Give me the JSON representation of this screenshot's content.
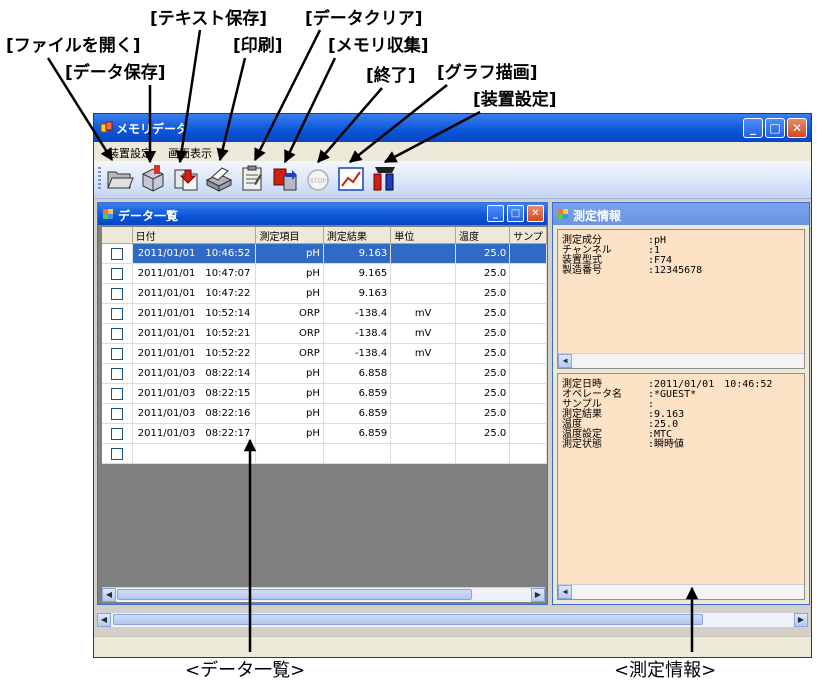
{
  "callouts": {
    "file_open": "[ファイルを開く]",
    "data_save": "[データ保存]",
    "text_save": "[テキスト保存]",
    "print": "[印刷]",
    "data_clear": "[データクリア]",
    "memory_collect": "[メモリ収集]",
    "exit": "[終了]",
    "graph_draw": "[グラフ描画]",
    "device_settings": "[装置設定]"
  },
  "captions": {
    "data_list": "<データ一覧>",
    "measurement_info": "<測定情報>"
  },
  "window": {
    "title": "メモリデータ",
    "menu": [
      "装置設定",
      "画面表示"
    ],
    "toolbar_icons": [
      "folder-open-icon",
      "save-icon",
      "text-save-icon",
      "printer-icon",
      "clipboard-clear-icon",
      "memory-collect-icon",
      "stop-icon",
      "graph-icon",
      "device-settings-icon"
    ]
  },
  "data_list": {
    "title": "データ一覧",
    "columns": [
      "",
      "日付",
      "測定項目",
      "測定結果",
      "単位",
      "温度",
      "サンプ"
    ],
    "rows": [
      {
        "date": "2011/01/01",
        "time": "10:46:52",
        "item": "pH",
        "result": "9.163",
        "unit": "",
        "temp": "25.0",
        "selected": true
      },
      {
        "date": "2011/01/01",
        "time": "10:47:07",
        "item": "pH",
        "result": "9.165",
        "unit": "",
        "temp": "25.0",
        "selected": false
      },
      {
        "date": "2011/01/01",
        "time": "10:47:22",
        "item": "pH",
        "result": "9.163",
        "unit": "",
        "temp": "25.0",
        "selected": false
      },
      {
        "date": "2011/01/01",
        "time": "10:52:14",
        "item": "ORP",
        "result": "-138.4",
        "unit": "mV",
        "temp": "25.0",
        "selected": false
      },
      {
        "date": "2011/01/01",
        "time": "10:52:21",
        "item": "ORP",
        "result": "-138.4",
        "unit": "mV",
        "temp": "25.0",
        "selected": false
      },
      {
        "date": "2011/01/01",
        "time": "10:52:22",
        "item": "ORP",
        "result": "-138.4",
        "unit": "mV",
        "temp": "25.0",
        "selected": false
      },
      {
        "date": "2011/01/03",
        "time": "08:22:14",
        "item": "pH",
        "result": "6.858",
        "unit": "",
        "temp": "25.0",
        "selected": false
      },
      {
        "date": "2011/01/03",
        "time": "08:22:15",
        "item": "pH",
        "result": "6.859",
        "unit": "",
        "temp": "25.0",
        "selected": false
      },
      {
        "date": "2011/01/03",
        "time": "08:22:16",
        "item": "pH",
        "result": "6.859",
        "unit": "",
        "temp": "25.0",
        "selected": false
      },
      {
        "date": "2011/01/03",
        "time": "08:22:17",
        "item": "pH",
        "result": "6.859",
        "unit": "",
        "temp": "25.0",
        "selected": false
      }
    ]
  },
  "measurement_info": {
    "title": "測定情報",
    "top_pane": [
      {
        "key": "測定成分",
        "value": ":pH"
      },
      {
        "key": "チャンネル",
        "value": ":1"
      },
      {
        "key": "装置型式",
        "value": ":F74"
      },
      {
        "key": "製造番号",
        "value": ":12345678"
      }
    ],
    "bottom_pane": [
      {
        "key": "測定日時",
        "value": ":2011/01/01　10:46:52"
      },
      {
        "key": "オペレータ名",
        "value": ":*GUEST*"
      },
      {
        "key": "サンプル",
        "value": ":"
      },
      {
        "key": "測定結果",
        "value": ":9.163"
      },
      {
        "key": "温度",
        "value": ":25.0"
      },
      {
        "key": "温度設定",
        "value": ":MTC"
      },
      {
        "key": "測定状態",
        "value": ":瞬時値"
      }
    ]
  },
  "colors": {
    "title_bar": "#0a55d8",
    "selected_row": "#316ac5",
    "info_pane_bg": "#fde2c6"
  }
}
